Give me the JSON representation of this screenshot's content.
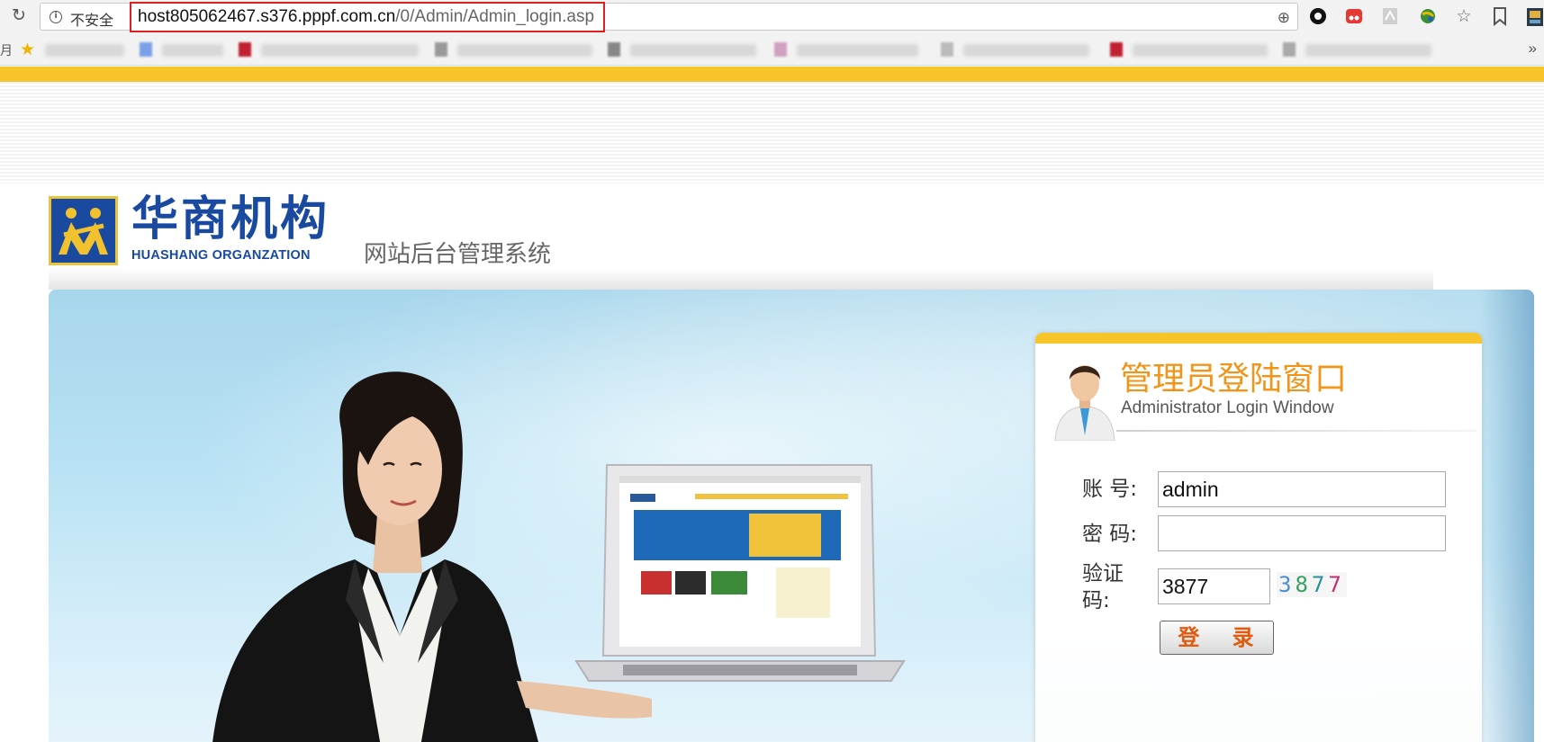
{
  "browser": {
    "security_label": "不安全",
    "url_host": "host805062467.s376.pppf.com.cn",
    "url_path": "/0/Admin/Admin_login.asp",
    "bookmarks_left_char": "月",
    "more_label": "»"
  },
  "header": {
    "logo_cn": "华商机构",
    "logo_en": "HUASHANG ORGANZATION",
    "system_title": "网站后台管理系统"
  },
  "login": {
    "title": "管理员登陆窗口",
    "subtitle": "Administrator Login Window",
    "account_label": "账 号:",
    "account_value": "admin",
    "password_label": "密 码:",
    "password_value": "",
    "captcha_label_line1": "验证",
    "captcha_label_line2": "码:",
    "captcha_input_value": "3877",
    "captcha_chars": [
      "3",
      "8",
      "7",
      "7"
    ],
    "login_button": "登 录"
  },
  "colors": {
    "accent_yellow": "#f7c42a",
    "brand_blue": "#1a4aa0",
    "title_orange": "#f29418",
    "url_highlight": "#e02020"
  }
}
